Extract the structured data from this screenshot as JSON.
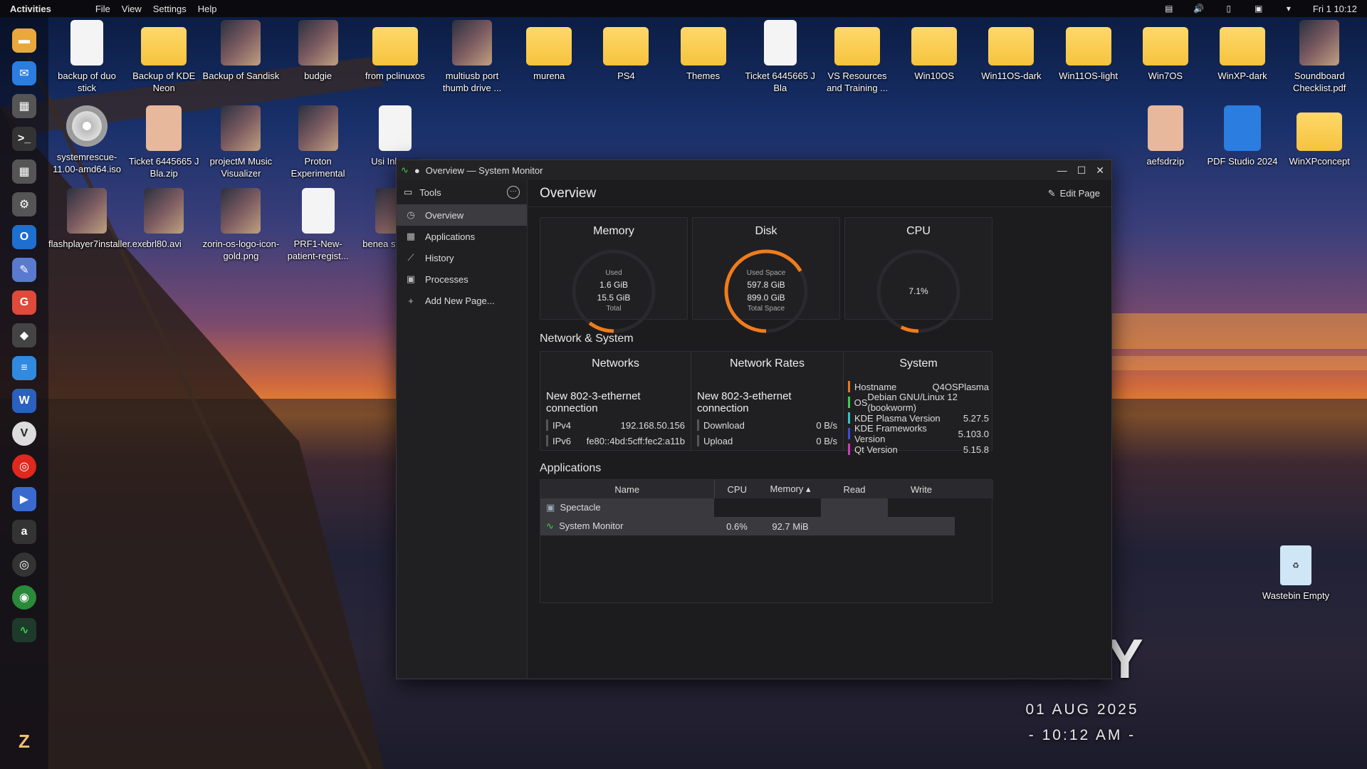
{
  "topbar": {
    "activities": "Activities",
    "menu": [
      "File",
      "View",
      "Settings",
      "Help"
    ],
    "clock": "Fri 1 10:12"
  },
  "desktop": {
    "row1": [
      "backup of duo stick",
      "Backup of KDE Neon",
      "Backup of Sandisk",
      "budgie",
      "from pclinuxos",
      "multiusb port thumb drive ...",
      "murena",
      "PS4",
      "Themes",
      "Ticket 6445665 J Bla",
      "VS Resources and Training ...",
      "Win10OS",
      "Win11OS-dark",
      "Win11OS-light",
      "Win7OS",
      "WinXP-dark",
      "Soundboard Checklist.pdf"
    ],
    "row2": [
      "systemrescue-11.00-amd64.iso",
      "Ticket 6445665 J Bla.zip",
      "projectM Music Visualizer",
      "Proton Experimental",
      "Usi Inkscap",
      "",
      "",
      "",
      "",
      "",
      "",
      "",
      "",
      "",
      "aefsdrzip",
      "PDF Studio 2024",
      "WinXPconcept"
    ],
    "row3": [
      "flashplayer7installer.exe",
      "brl80.avi",
      "zorin-os-logo-icon-gold.png",
      "PRF1-New-patient-regist...",
      "benea steel-sky"
    ],
    "trash": "Wastebin Empty"
  },
  "clock_widget": {
    "day": "DAY",
    "date": "01 AUG 2025",
    "time": "- 10:12 AM -"
  },
  "window": {
    "title": "Overview — System Monitor",
    "sidebar": {
      "header": "Tools",
      "items": [
        "Overview",
        "Applications",
        "History",
        "Processes",
        "Add New Page..."
      ]
    },
    "page_title": "Overview",
    "edit_label": "Edit Page",
    "memory": {
      "title": "Memory",
      "used_label": "Used",
      "used": "1.6 GiB",
      "total": "15.5 GiB",
      "total_label": "Total",
      "fraction": 0.103
    },
    "disk": {
      "title": "Disk",
      "used_label": "Used Space",
      "used": "597.8 GiB",
      "total": "899.0 GiB",
      "total_label": "Total Space",
      "fraction": 0.665
    },
    "cpu": {
      "title": "CPU",
      "value": "7.1%",
      "fraction": 0.071
    },
    "netsys_title": "Network & System",
    "networks": {
      "title": "Networks",
      "connection": "New 802-3-ethernet connection",
      "rows": [
        {
          "k": "IPv4",
          "v": "192.168.50.156"
        },
        {
          "k": "IPv6",
          "v": "fe80::4bd:5cff:fec2:a11b"
        }
      ]
    },
    "rates": {
      "title": "Network Rates",
      "connection": "New 802-3-ethernet connection",
      "rows": [
        {
          "k": "Download",
          "v": "0 B/s"
        },
        {
          "k": "Upload",
          "v": "0 B/s"
        }
      ]
    },
    "system": {
      "title": "System",
      "rows": [
        {
          "k": "Hostname",
          "v": "Q4OSPlasma",
          "color": "#e8761d"
        },
        {
          "k": "OS",
          "v": "Debian GNU/Linux 12 (bookworm)",
          "color": "#3ad04a"
        },
        {
          "k": "KDE Plasma Version",
          "v": "5.27.5",
          "color": "#2ec6c6"
        },
        {
          "k": "KDE Frameworks Version",
          "v": "5.103.0",
          "color": "#3a4be0"
        },
        {
          "k": "Qt Version",
          "v": "5.15.8",
          "color": "#d03ac0"
        }
      ]
    },
    "apps_title": "Applications",
    "apps_columns": [
      "Name",
      "CPU",
      "Memory",
      "Read",
      "Write"
    ],
    "apps": [
      {
        "name": "Spectacle",
        "cpu": "",
        "mem": ""
      },
      {
        "name": "System Monitor",
        "cpu": "0.6%",
        "mem": "92.7 MiB"
      }
    ]
  },
  "colors": {
    "accent": "#f07c1c",
    "sidebar_active": "#3b3b40"
  }
}
